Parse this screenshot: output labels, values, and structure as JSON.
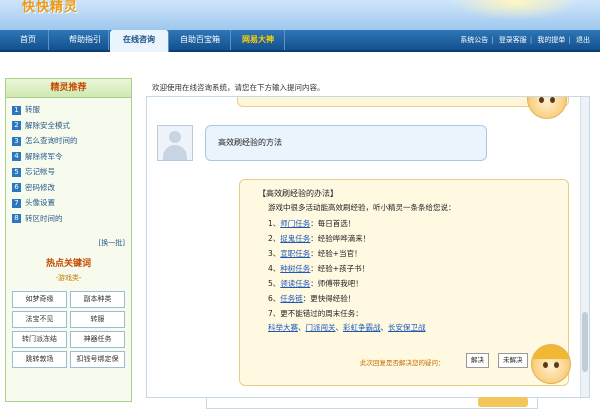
{
  "header": {
    "logo_text": "快快精灵"
  },
  "nav": {
    "tabs": [
      {
        "label": "首页"
      },
      {
        "label": "帮助指引"
      },
      {
        "label": "在线咨询"
      },
      {
        "label": "自助百宝箱"
      },
      {
        "label": "网易大神"
      }
    ],
    "right_links": [
      "系统公告",
      "登录客服",
      "我的提单",
      "退出"
    ]
  },
  "sidebar": {
    "title": "精灵推荐",
    "items": [
      {
        "num": "1",
        "label": "转服"
      },
      {
        "num": "2",
        "label": "解除安全模式"
      },
      {
        "num": "3",
        "label": "怎么查询时间的"
      },
      {
        "num": "4",
        "label": "解除将军令"
      },
      {
        "num": "5",
        "label": "忘记帐号"
      },
      {
        "num": "6",
        "label": "密码修改"
      },
      {
        "num": "7",
        "label": "头像设置"
      },
      {
        "num": "8",
        "label": "转区时间的"
      }
    ],
    "swap_label": "[换一批]",
    "hot_title": "热点关键词",
    "hot_sub": "-游戏类-",
    "keywords": [
      "如梦奇缘",
      "副本种类",
      "法宝不见",
      "转服",
      "转门派冻结",
      "神器任务",
      "跳转敦场",
      "扣钱号绑定保"
    ]
  },
  "chat": {
    "welcome": "欢迎使用在线咨询系统，请您在下方输入提问内容。",
    "question": "高效刷经验的方法",
    "answer": {
      "title": "【高效刷经验的办法】",
      "intro": "游戏中很多活动能高效刷经验，听小精灵一条条给您说：",
      "lines": [
        {
          "prefix": "1、",
          "link": "师门任务",
          "text": "：每日首选！"
        },
        {
          "prefix": "2、",
          "link": "捉鬼任务",
          "text": "：经验哗哗滴来！"
        },
        {
          "prefix": "3、",
          "link": "宣职任务",
          "text": "：经验+当官！"
        },
        {
          "prefix": "4、",
          "link": "种树任务",
          "text": "：经验+孩子书！"
        },
        {
          "prefix": "5、",
          "link": "领读任务",
          "text": "：师傅带我吧！"
        },
        {
          "prefix": "6、",
          "link": "任务链",
          "text": "：更快得经验！"
        },
        {
          "prefix": "7、",
          "link": "",
          "text": "更不能错过的周末任务："
        }
      ],
      "weekend_links": [
        "科举大赛",
        "门派闯关",
        "彩虹争霸战",
        "长安保卫战"
      ],
      "feedback_prompt": "此次回复是否解决您的疑问：",
      "btn_solved": "解决",
      "btn_unsolved": "未解决"
    }
  }
}
